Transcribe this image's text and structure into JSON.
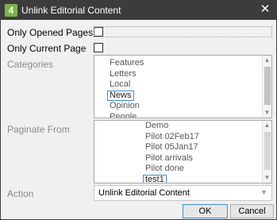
{
  "window": {
    "icon_label": "4",
    "title": "Unlink Editorial Content",
    "close_glyph": "✕"
  },
  "options": {
    "only_opened_pages_label": "Only Opened Pages",
    "only_opened_pages_checked": false,
    "only_current_page_label": "Only Current Page",
    "only_current_page_checked": false
  },
  "categories": {
    "label": "Categories",
    "items": [
      "Features",
      "Letters",
      "Local",
      "News",
      "Opinion",
      "People"
    ],
    "selected": "News"
  },
  "paginate_from": {
    "label": "Paginate From",
    "items": [
      "Demo",
      "Pilot 02Feb17",
      "Pilot 05Jan17",
      "Pilot arrivals",
      "Pilot done",
      "test1"
    ],
    "selected": "test1"
  },
  "action": {
    "label": "Action",
    "value": "Unlink Editorial Content"
  },
  "buttons": {
    "ok": "OK",
    "cancel": "Cancel"
  },
  "scrollbar_glyphs": {
    "up": "▲",
    "down": "▼"
  },
  "dropdown_glyph": "▼"
}
